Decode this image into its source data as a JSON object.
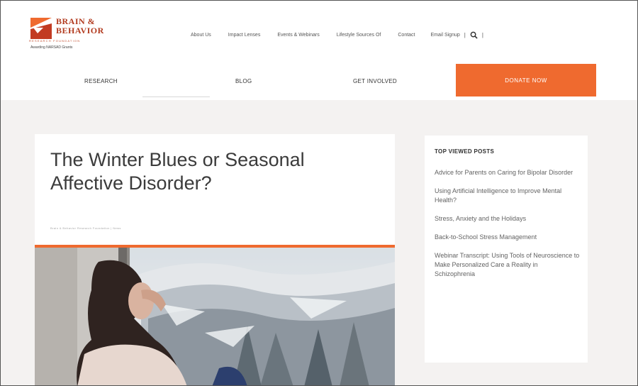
{
  "logo": {
    "line1": "BRAIN &",
    "line2": "BEHAVIOR",
    "line3": "RESEARCH FOUNDATION",
    "line4": "Awarding NARSAD Grants",
    "mark_colors": [
      "#ef6a2f",
      "#c23b22"
    ]
  },
  "utility_nav": {
    "items": [
      "About Us",
      "Impact Lenses",
      "Events & Webinars",
      "Lifestyle Sources Of",
      "Contact",
      "Email Signup"
    ],
    "separator": "|"
  },
  "main_nav": {
    "items": [
      "RESEARCH",
      "BLOG",
      "GET INVOLVED"
    ],
    "donate_label": "DONATE NOW"
  },
  "article": {
    "title": "The Winter Blues or Seasonal Affective Disorder?",
    "meta": "Brain & Behavior Research Foundation | News"
  },
  "sidebar": {
    "heading": "TOP VIEWED POSTS",
    "posts": [
      "Advice for Parents on Caring for Bipolar Disorder",
      "Using Artificial Intelligence to Improve Mental Health?",
      "Stress, Anxiety and the Holidays",
      "Back-to-School Stress Management",
      "Webinar Transcript: Using Tools of Neuroscience to Make Personalized Care a Reality in Schizophrenia"
    ]
  },
  "colors": {
    "accent": "#ef6a2f",
    "brand_dark": "#b23a1e",
    "content_bg": "#f4f2f1"
  }
}
